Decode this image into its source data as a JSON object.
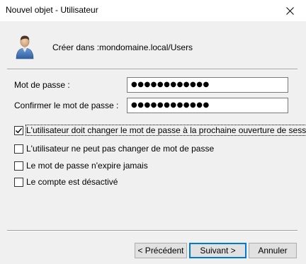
{
  "window": {
    "title": "Nouvel objet - Utilisateur"
  },
  "create_in": {
    "label": "Créer dans :",
    "value": "mondomaine.local/Users"
  },
  "fields": {
    "password": {
      "label": "Mot de passe :",
      "value": "●●●●●●●●●●●●"
    },
    "confirm": {
      "label": "Confirmer le mot de passe :",
      "value": "●●●●●●●●●●●●"
    }
  },
  "options": [
    {
      "label": "L'utilisateur doit changer le mot de passe à la prochaine ouverture de session",
      "checked": true
    },
    {
      "label": "L'utilisateur ne peut pas changer de mot de passe",
      "checked": false
    },
    {
      "label": "Le mot de passe n'expire jamais",
      "checked": false
    },
    {
      "label": "Le compte est désactivé",
      "checked": false
    }
  ],
  "buttons": {
    "previous": "< Précédent",
    "next": "Suivant >",
    "cancel": "Annuler"
  },
  "colors": {
    "accent": "#0078d7",
    "background": "#f0f0f0"
  },
  "icons": {
    "close": "close-icon",
    "user": "user-icon",
    "check": "check-icon"
  }
}
